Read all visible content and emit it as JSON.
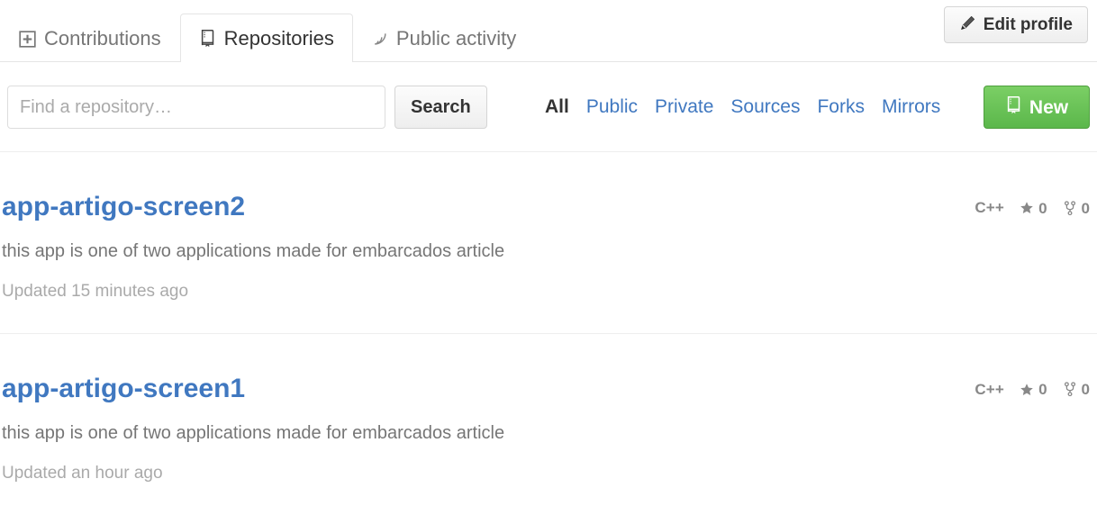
{
  "tabnav": {
    "tabs": [
      {
        "label": "Contributions",
        "icon": "contributions-plus-icon",
        "selected": false
      },
      {
        "label": "Repositories",
        "icon": "repo-book-icon",
        "selected": true
      },
      {
        "label": "Public activity",
        "icon": "rss-feed-icon",
        "selected": false
      }
    ],
    "edit_profile": {
      "label": "Edit profile",
      "icon": "pencil-icon"
    }
  },
  "filter_bar": {
    "search": {
      "placeholder": "Find a repository…",
      "value": "",
      "button_label": "Search"
    },
    "filters": [
      {
        "label": "All",
        "selected": true
      },
      {
        "label": "Public",
        "selected": false
      },
      {
        "label": "Private",
        "selected": false
      },
      {
        "label": "Sources",
        "selected": false
      },
      {
        "label": "Forks",
        "selected": false
      },
      {
        "label": "Mirrors",
        "selected": false
      }
    ],
    "new_button": {
      "label": "New",
      "icon": "repo-book-icon"
    }
  },
  "repositories": [
    {
      "name": "app-artigo-screen2",
      "description": "this app is one of two applications made for embarcados article",
      "updated": "Updated 15 minutes ago",
      "language": "C++",
      "stars": "0",
      "forks": "0"
    },
    {
      "name": "app-artigo-screen1",
      "description": "this app is one of two applications made for embarcados article",
      "updated": "Updated an hour ago",
      "language": "C++",
      "stars": "0",
      "forks": "0"
    }
  ],
  "colors": {
    "link_blue": "#4078c0",
    "green_button": "#6cc644",
    "muted_text": "#767676",
    "meta_text": "#888888"
  }
}
